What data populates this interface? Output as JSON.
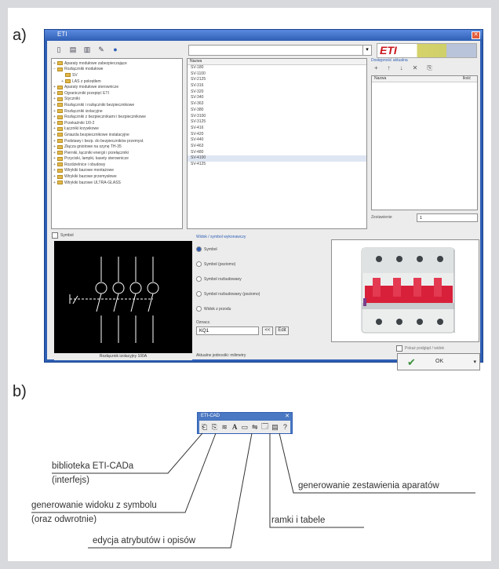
{
  "labels": {
    "a": "a)",
    "b": "b)"
  },
  "window": {
    "title": "ETI",
    "close_glyph": "✕",
    "logo_text": "ETI",
    "combo_arrow": "▾",
    "toolbar_icons": [
      "new-icon",
      "open-icon",
      "save-icon",
      "settings-icon",
      "help-icon"
    ],
    "search_icons": [
      "search-icon",
      "bookmark-icon"
    ],
    "tree": [
      {
        "label": "Aparaty modułowe zabezpieczające",
        "exp": "+"
      },
      {
        "label": "Rozłączniki modułowe",
        "exp": "−"
      },
      {
        "label": "SV",
        "exp": "",
        "child": true
      },
      {
        "label": "LAS z pokrętłem",
        "exp": "+",
        "child": true
      },
      {
        "label": "Aparaty modułowe sterownicze",
        "exp": "+"
      },
      {
        "label": "Ograniczniki przepięć ETI",
        "exp": "+"
      },
      {
        "label": "Styczniki",
        "exp": "+"
      },
      {
        "label": "Rozłączniki i rozłączniki bezpiecznikowe",
        "exp": "+"
      },
      {
        "label": "Rozłączniki izolacyjne",
        "exp": "+"
      },
      {
        "label": "Rozłączniki z bezpiecznikami i bezpiecznikowe",
        "exp": "+"
      },
      {
        "label": "Przekaźniki 1/0-2",
        "exp": "+"
      },
      {
        "label": "Łączniki krzywkowe",
        "exp": "+"
      },
      {
        "label": "Gniazda bezpiecznikowe instalacyjne",
        "exp": "+"
      },
      {
        "label": "Podstawy i bezp. do bezpieczników przemysł.",
        "exp": "+"
      },
      {
        "label": "Złącza gniotowe na szynę TH-35",
        "exp": "+"
      },
      {
        "label": "Pierniki, łączniki energii i przełączniki",
        "exp": "+"
      },
      {
        "label": "Przyciski, lampki, kasety sterownicze",
        "exp": "+"
      },
      {
        "label": "Rozdzielnice i obudowy",
        "exp": "+"
      },
      {
        "label": "Wtrykiki bazowe montażowe",
        "exp": "+"
      },
      {
        "label": "Wtrykiki bazowe przemysłowe",
        "exp": "+"
      },
      {
        "label": "Wtrykiki bazowe ULTRA-GLASS",
        "exp": "+"
      }
    ],
    "list_header": "Nazwa",
    "list": [
      "SV-180",
      "SV-1100",
      "SV-2125",
      "SV-316",
      "SV-320",
      "SV-340",
      "SV-363",
      "SV-380",
      "SV-3100",
      "SV-3125",
      "SV-416",
      "SV-420",
      "SV-440",
      "SV-463",
      "SV-480",
      "SV-4100",
      "SV-4125"
    ],
    "right_panel": {
      "title": "Dostępność aktualna",
      "actions": [
        "+",
        "↑",
        "↓",
        "✕",
        "⎘"
      ],
      "col1": "Nazwa",
      "col2": "Ilość",
      "bottom_label": "Zestawienie",
      "bottom_value": "1"
    },
    "options": {
      "title": "Widok / symbol wykonawczy",
      "radios": [
        "Symbol",
        "Symbol (poziomo)",
        "Symbol rozbudowany",
        "Symbol rozbudowany (poziomo)",
        "Widok z przodu"
      ],
      "selected": 0,
      "name_label": "Oznacz.",
      "name_value": "KQ1",
      "btn1": "<<",
      "btn2": "Edit"
    },
    "status_text": "Aktualne jednostki: milimetry",
    "preview_caption": "Rozłącznik izolacyjny 100A",
    "checkbox_left": "Symbol",
    "checkbox_right": "Pokaż podgląd / widok",
    "ok_label": "OK"
  },
  "toolbar_b": {
    "title": "ETI-CAD",
    "close": "✕",
    "icons": [
      "library-icon",
      "view-from-symbol-icon",
      "symbol-from-view-icon",
      "attributes-icon",
      "frames-icon",
      "tables-icon",
      "list-icon",
      "layers-icon",
      "help-icon"
    ],
    "glyphs": [
      "⎗",
      "⎘",
      "≋",
      "A",
      "▭",
      "⇋",
      "🗔",
      "▤",
      "?"
    ]
  },
  "annotations": {
    "library_1": "biblioteka ETI-CADa",
    "library_2": "(interfejs)",
    "view_1": "generowanie widoku z symbolu",
    "view_2": "(oraz odwrotnie)",
    "attrs": "edycja atrybutów i opisów",
    "frames": "ramki i tabele",
    "list": "generowanie zestawienia aparatów"
  },
  "colors": {
    "accent": "#2f5fb4",
    "eti_red": "#c8171e",
    "breaker_red": "#d8203a"
  }
}
